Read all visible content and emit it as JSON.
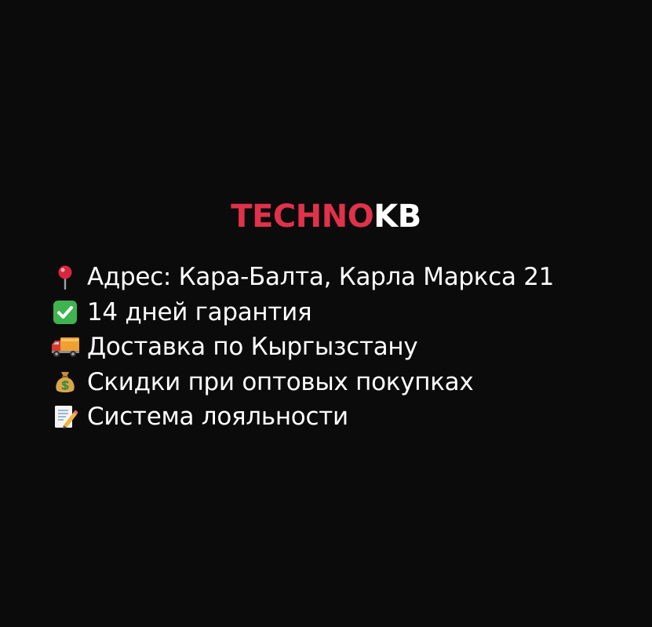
{
  "logo": {
    "part_a": "TECHNO",
    "part_b": "KB",
    "color_a": "#e0324a",
    "color_b": "#ffffff"
  },
  "features": [
    {
      "icon": "pushpin-icon",
      "text": "Адрес: Кара-Балта, Карла Маркса 21"
    },
    {
      "icon": "check-mark-button-icon",
      "text": "14 дней гарантия"
    },
    {
      "icon": "delivery-truck-icon",
      "text": "Доставка по Кыргызстану"
    },
    {
      "icon": "money-bag-icon",
      "text": "Скидки при оптовых покупках"
    },
    {
      "icon": "memo-icon",
      "text": "Система лояльности"
    }
  ],
  "colors": {
    "background": "#0b0b0b",
    "text": "#ffffff"
  }
}
